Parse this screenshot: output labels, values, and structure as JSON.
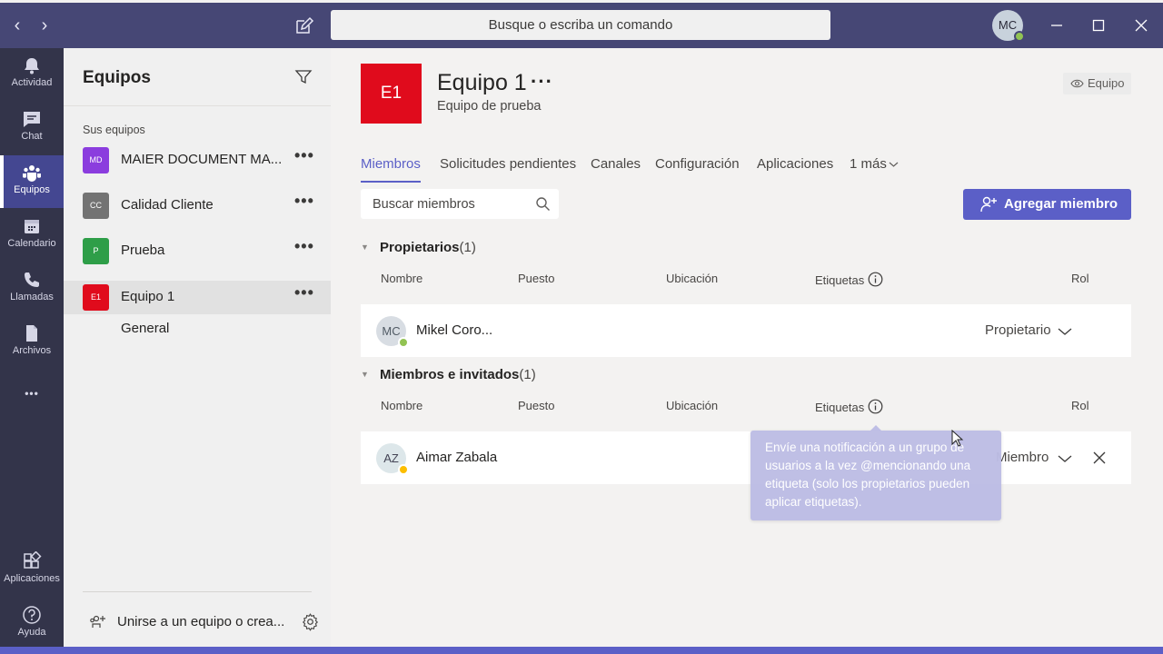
{
  "titlebar": {
    "search_placeholder": "Busque o escriba un comando",
    "user_initials": "MC",
    "back_glyph": "‹",
    "forward_glyph": "›"
  },
  "appbar": {
    "items": [
      {
        "label": "Actividad",
        "icon": "bell-icon"
      },
      {
        "label": "Chat",
        "icon": "chat-icon"
      },
      {
        "label": "Equipos",
        "icon": "teams-icon",
        "active": true
      },
      {
        "label": "Calendario",
        "icon": "calendar-icon"
      },
      {
        "label": "Llamadas",
        "icon": "phone-icon"
      },
      {
        "label": "Archivos",
        "icon": "file-icon"
      }
    ],
    "more_glyph": "•••",
    "bottom_items": [
      {
        "label": "Aplicaciones",
        "icon": "apps-icon"
      },
      {
        "label": "Ayuda",
        "icon": "help-icon"
      }
    ]
  },
  "pane": {
    "title": "Equipos",
    "section_label": "Sus equipos",
    "teams": [
      {
        "initials": "MD",
        "name": "MAIER DOCUMENT MA...",
        "color": "#8b3dde"
      },
      {
        "initials": "CC",
        "name": "Calidad Cliente",
        "color": "#737373"
      },
      {
        "initials": "P",
        "name": "Prueba",
        "color": "#2e9e48"
      },
      {
        "initials": "E1",
        "name": "Equipo 1",
        "color": "#e00b1c",
        "selected": true
      }
    ],
    "more_glyph": "•••",
    "channel": "General",
    "join_text": "Unirse a un equipo o crea..."
  },
  "main": {
    "logo_initials": "E1",
    "logo_color": "#e00b1c",
    "title": "Equipo 1",
    "title_more": "···",
    "description": "Equipo de prueba",
    "visibility_pill": "Equipo",
    "tabs": [
      {
        "label": "Miembros",
        "active": true
      },
      {
        "label": "Solicitudes pendientes"
      },
      {
        "label": "Canales"
      },
      {
        "label": "Configuración"
      },
      {
        "label": "Aplicaciones"
      },
      {
        "label": "1 más"
      }
    ],
    "search_placeholder": "Buscar miembros",
    "add_member_label": "Agregar miembro",
    "accent": "#5b5fc7",
    "columns": {
      "name": "Nombre",
      "title": "Puesto",
      "location": "Ubicación",
      "tags": "Etiquetas",
      "role": "Rol"
    },
    "owners_group": {
      "label": "Propietarios",
      "count": "(1)"
    },
    "members_group": {
      "label": "Miembros e invitados",
      "count": "(1)"
    },
    "owners": [
      {
        "initials": "MC",
        "name": "Mikel Coro...",
        "role": "Propietario",
        "status": "available",
        "status_color": "#92c353"
      }
    ],
    "members": [
      {
        "initials": "AZ",
        "name": "Aimar Zabala",
        "role": "Miembro",
        "status": "away",
        "status_color": "#fcbe00"
      }
    ],
    "tooltip": "Envíe una notificación a un grupo de usuarios a la vez @mencionando una etiqueta (solo los propietarios pueden aplicar etiquetas)."
  }
}
